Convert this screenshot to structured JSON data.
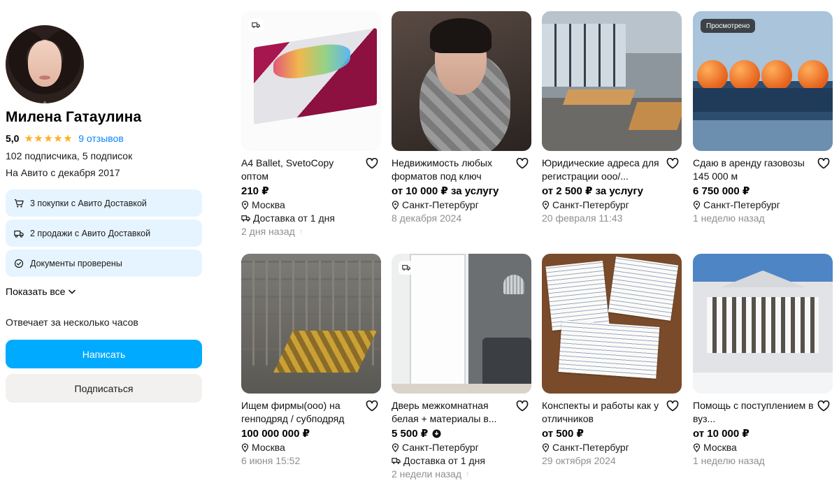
{
  "profile": {
    "name": "Милена Гатаулина",
    "rating": "5,0",
    "stars": "★★★★★",
    "reviews": "9 отзывов",
    "followers": "102 подписчика, 5 подписок",
    "since": "На Авито с декабря 2017",
    "badges": [
      {
        "label": "3 покупки с Авито Доставкой",
        "icon": "cart-icon"
      },
      {
        "label": "2 продажи с Авито Доставкой",
        "icon": "truck-icon"
      },
      {
        "label": "Документы проверены",
        "icon": "check-circle-icon"
      }
    ],
    "show_all": "Показать все",
    "responds": "Отвечает за несколько часов",
    "write_button": "Написать",
    "subscribe_button": "Подписаться"
  },
  "listings": [
    {
      "title": "A4 Ballet, SvetoCopy оптом",
      "price": "210 ₽",
      "location": "Москва",
      "delivery": "Доставка от 1 дня",
      "date": "2 дня назад",
      "badge": "delivery-icon"
    },
    {
      "title": "Недвижимость любых форматов под ключ",
      "price": "от 10 000 ₽ за услугу",
      "location": "Санкт-Петербург",
      "date": "8 декабря 2024"
    },
    {
      "title": "Юридические адреса для регистрации ооо/...",
      "price": "от 2 500 ₽ за услугу",
      "location": "Санкт-Петербург",
      "date": "20 февраля 11:43"
    },
    {
      "title": "Сдаю в аренду газовозы 145 000 м",
      "price": "6 750 000 ₽",
      "location": "Санкт-Петербург",
      "date": "1 неделю назад",
      "badge_text": "Просмотрено"
    },
    {
      "title": "Ищем фирмы(ооо) на генподряд / субподряд",
      "price": "100 000 000 ₽",
      "location": "Москва",
      "date": "6 июня 15:52"
    },
    {
      "title": "Дверь межкомнатная белая + материалы в...",
      "price": "5 500 ₽",
      "location": "Санкт-Петербург",
      "delivery": "Доставка от 1 дня",
      "date": "2 недели назад",
      "badge": "delivery-icon"
    },
    {
      "title": "Конспекты и работы как у отличников",
      "price": "от 500 ₽",
      "location": "Санкт-Петербург",
      "date": "29 октября 2024"
    },
    {
      "title": "Помощь с поступлением в вуз...",
      "price": "от 10 000 ₽",
      "location": "Москва",
      "date": "1 неделю назад"
    }
  ],
  "colors": {
    "accent": "#00aaff",
    "badge_bg": "#e6f4ff",
    "star": "#ffb021",
    "link": "#0a84ff",
    "muted": "#8f8f8f"
  }
}
